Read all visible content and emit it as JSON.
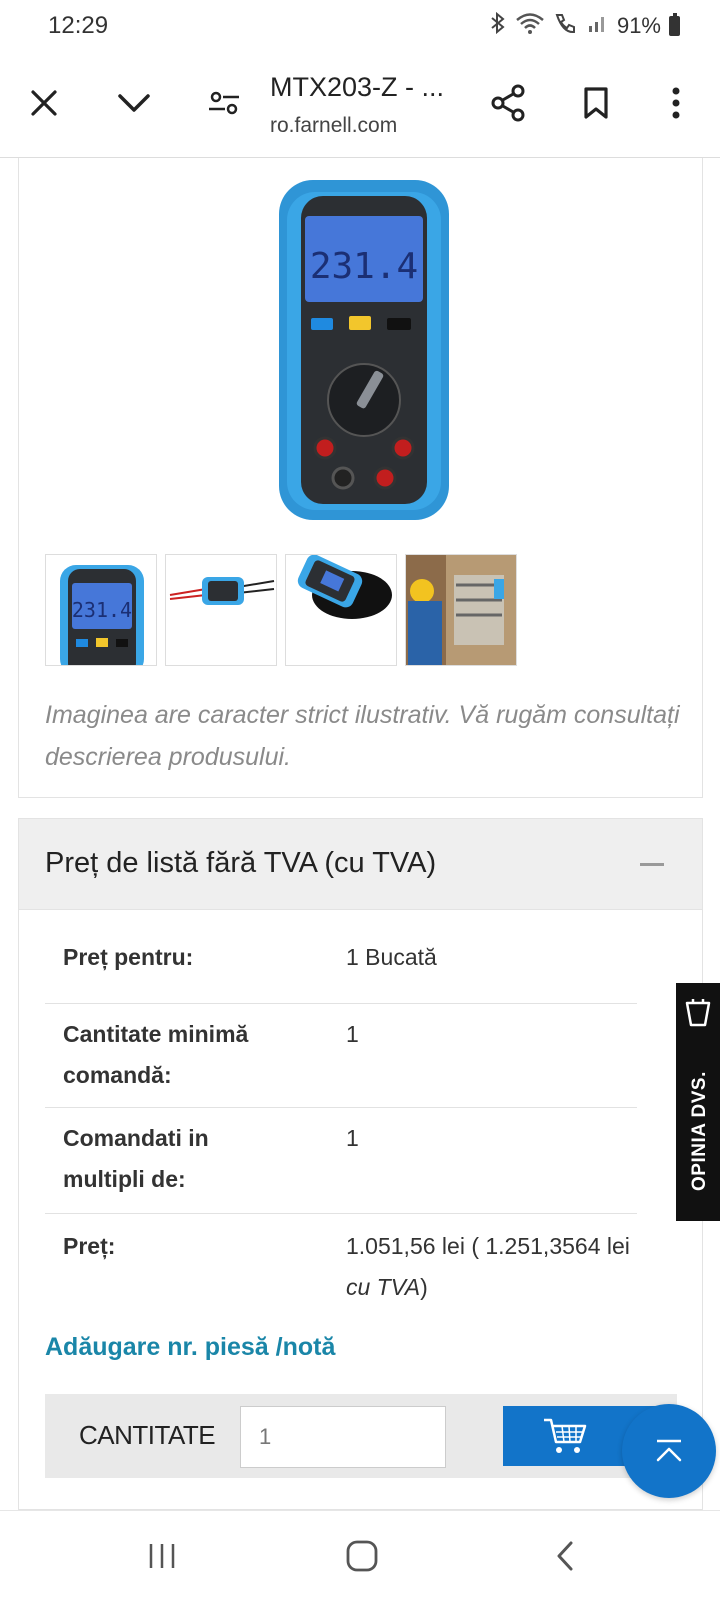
{
  "status_bar": {
    "time": "12:29",
    "battery_percent": "91%",
    "icons": [
      "bluetooth-icon",
      "wifi-icon",
      "wifi-call-icon",
      "signal-icon",
      "battery-icon"
    ]
  },
  "browser": {
    "title": "MTX203-Z - ...",
    "url": "ro.farnell.com",
    "icons": [
      "close-icon",
      "chevron-down-icon",
      "tune-icon",
      "share-icon",
      "bookmark-icon",
      "more-vert-icon"
    ]
  },
  "product_image": {
    "display_digits": "231.4",
    "thumbnails": [
      "multimeter-front",
      "multimeter-with-leads",
      "multimeter-angled",
      "technician-measuring"
    ],
    "disclaimer": "Imaginea are caracter strict ilustrativ. Vă rugăm consultați descrierea produsului."
  },
  "price_section": {
    "title": "Preț de listă fără TVA (cu TVA)",
    "rows": [
      {
        "label": "Preț pentru:",
        "value": "1 Bucată"
      },
      {
        "label": "Cantitate minimă comandă:",
        "value": "1"
      },
      {
        "label": "Comandati in multipli de:",
        "value": "1"
      },
      {
        "label": "Preț:",
        "value": "1.051,56 lei ( 1.251,3564 lei",
        "value_suffix": "cu TVA",
        "value_end": ")"
      }
    ],
    "add_part_link": "Adăugare nr. piesă /notă",
    "quantity_label": "CANTITATE",
    "quantity_value": "1"
  },
  "feedback_tab": {
    "label": "OPINIA DVS."
  },
  "colors": {
    "accent_blue": "#1274c9",
    "link_teal": "#1a86a8",
    "feedback_bg": "#111111"
  }
}
